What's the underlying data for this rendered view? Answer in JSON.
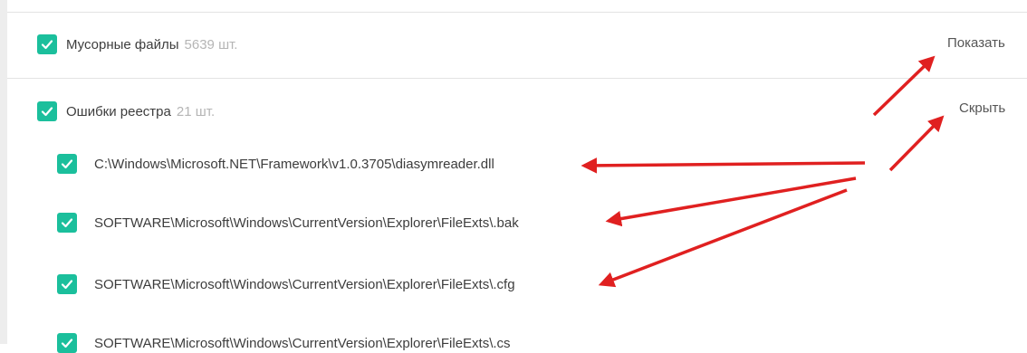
{
  "categories": [
    {
      "label": "Мусорные файлы",
      "count": "5639 шт.",
      "action": "Показать",
      "checked": true
    },
    {
      "label": "Ошибки реестра",
      "count": "21 шт.",
      "action": "Скрыть",
      "checked": true
    }
  ],
  "registry_items": [
    "C:\\Windows\\Microsoft.NET\\Framework\\v1.0.3705\\diasymreader.dll",
    "SOFTWARE\\Microsoft\\Windows\\CurrentVersion\\Explorer\\FileExts\\.bak",
    "SOFTWARE\\Microsoft\\Windows\\CurrentVersion\\Explorer\\FileExts\\.cfg",
    "SOFTWARE\\Microsoft\\Windows\\CurrentVersion\\Explorer\\FileExts\\.cs"
  ],
  "colors": {
    "checkbox": "#1bbf9c",
    "annotation_arrow": "#e02020"
  },
  "icons": {
    "checkbox": "check-icon",
    "annotation": "arrow-icon"
  }
}
